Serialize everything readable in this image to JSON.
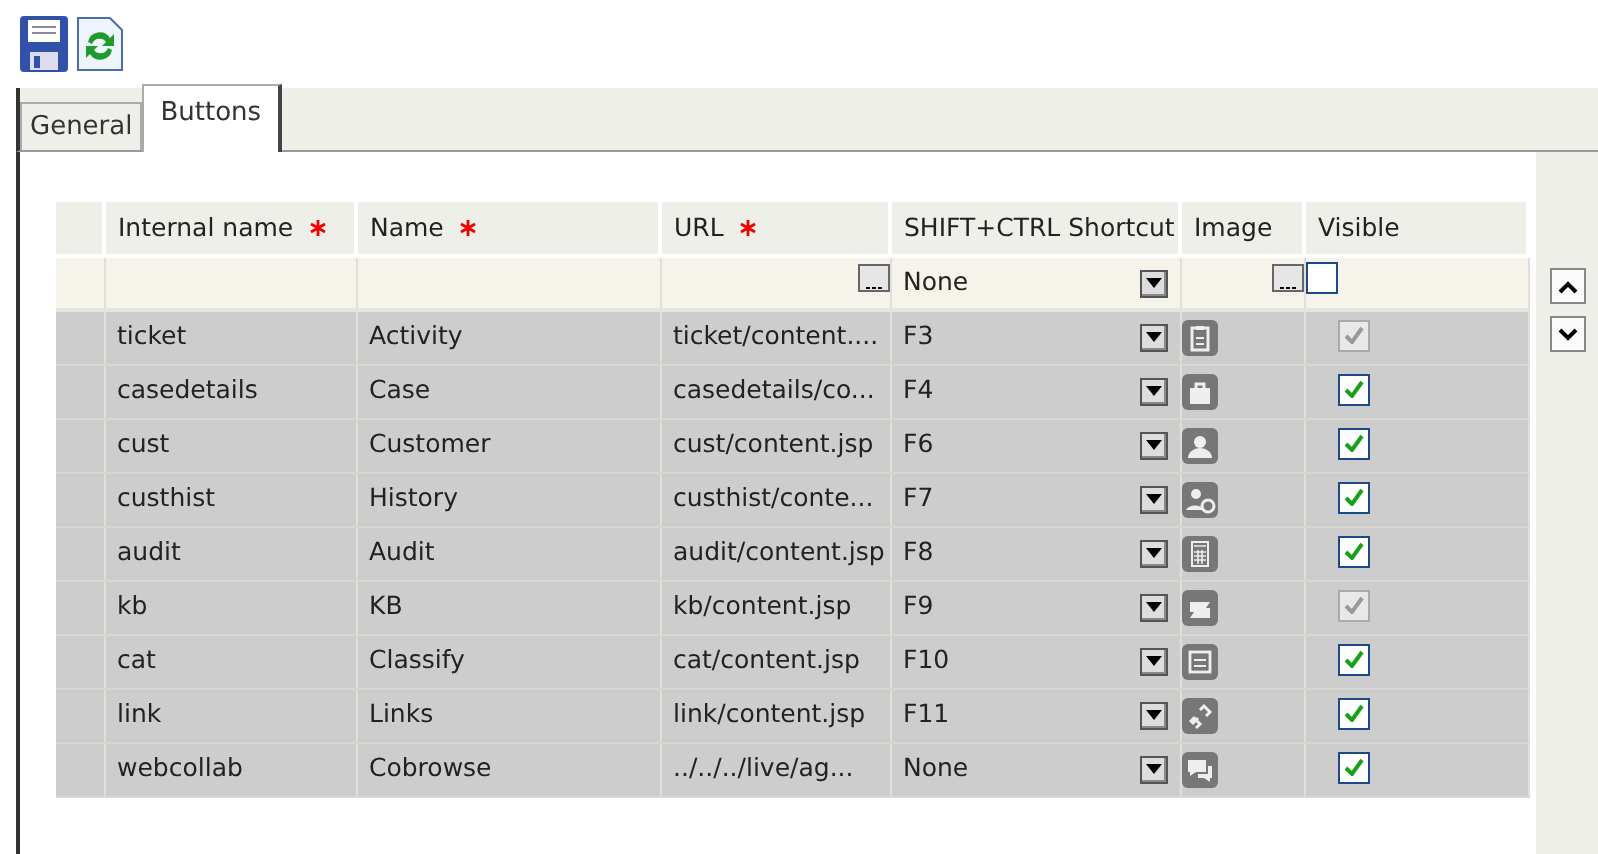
{
  "tabs": [
    {
      "label": "General",
      "selected": false
    },
    {
      "label": "Buttons",
      "selected": true
    }
  ],
  "table": {
    "columns": [
      {
        "label": "Internal name",
        "required": true
      },
      {
        "label": "Name",
        "required": true
      },
      {
        "label": "URL",
        "required": true
      },
      {
        "label": "SHIFT+CTRL Shortcut",
        "required": false
      },
      {
        "label": "Image",
        "required": false
      },
      {
        "label": "Visible",
        "required": false
      }
    ],
    "new_row": {
      "shortcut": "None",
      "visible": false
    },
    "rows": [
      {
        "internal_name": "ticket",
        "name": "Activity",
        "url": "ticket/content....",
        "shortcut": "F3",
        "visible": true,
        "disabled": true
      },
      {
        "internal_name": "casedetails",
        "name": "Case",
        "url": "casedetails/co...",
        "shortcut": "F4",
        "visible": true,
        "disabled": false
      },
      {
        "internal_name": "cust",
        "name": "Customer",
        "url": "cust/content.jsp",
        "shortcut": "F6",
        "visible": true,
        "disabled": false
      },
      {
        "internal_name": "custhist",
        "name": "History",
        "url": "custhist/conte...",
        "shortcut": "F7",
        "visible": true,
        "disabled": false
      },
      {
        "internal_name": "audit",
        "name": "Audit",
        "url": "audit/content.jsp",
        "shortcut": "F8",
        "visible": true,
        "disabled": false
      },
      {
        "internal_name": "kb",
        "name": "KB",
        "url": "kb/content.jsp",
        "shortcut": "F9",
        "visible": true,
        "disabled": true
      },
      {
        "internal_name": "cat",
        "name": "Classify",
        "url": "cat/content.jsp",
        "shortcut": "F10",
        "visible": true,
        "disabled": false
      },
      {
        "internal_name": "link",
        "name": "Links",
        "url": "link/content.jsp",
        "shortcut": "F11",
        "visible": true,
        "disabled": false
      },
      {
        "internal_name": "webcollab",
        "name": "Cobrowse",
        "url": "../../../live/ag...",
        "shortcut": "None",
        "visible": true,
        "disabled": false
      }
    ]
  }
}
